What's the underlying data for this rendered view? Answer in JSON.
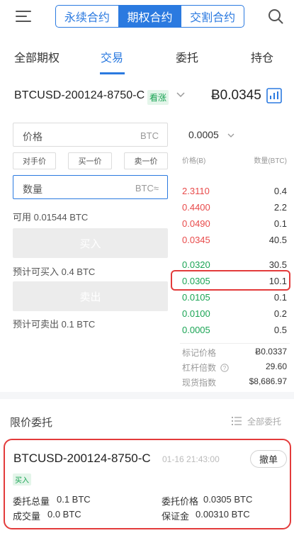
{
  "header": {
    "segments": [
      "永续合约",
      "期权合约",
      "交割合约"
    ],
    "active_segment": 1
  },
  "tabs": [
    "全部期权",
    "交易",
    "委托",
    "持仓"
  ],
  "active_tab": 1,
  "contract": {
    "name": "BTCUSD-200124-8750-C",
    "badge": "看涨",
    "price": "Ƀ0.0345"
  },
  "form": {
    "price_label": "价格",
    "price_unit": "BTC",
    "quick": [
      "对手价",
      "买一价",
      "卖一价"
    ],
    "qty_label": "数量",
    "qty_unit": "BTC≈",
    "available": "可用 0.01544 BTC",
    "buy_label": "买入",
    "est_buy": "预计可买入 0.4 BTC",
    "sell_label": "卖出",
    "est_sell": "预计可卖出 0.1 BTC"
  },
  "orderbook": {
    "depth_select": "0.0005",
    "price_header": "价格(Ƀ)",
    "qty_header": "数量(BTC)",
    "asks": [
      {
        "price": "2.3110",
        "qty": "0.4"
      },
      {
        "price": "0.4400",
        "qty": "2.2"
      },
      {
        "price": "0.0490",
        "qty": "0.1"
      },
      {
        "price": "0.0345",
        "qty": "40.5"
      }
    ],
    "bids": [
      {
        "price": "0.0320",
        "qty": "30.5"
      },
      {
        "price": "0.0305",
        "qty": "10.1"
      },
      {
        "price": "0.0105",
        "qty": "0.1"
      },
      {
        "price": "0.0100",
        "qty": "0.2"
      },
      {
        "price": "0.0005",
        "qty": "0.5"
      }
    ],
    "stats": [
      {
        "label": "标记价格",
        "value": "Ƀ0.0337"
      },
      {
        "label": "杠杆倍数",
        "value": "29.60"
      },
      {
        "label": "现货指数",
        "value": "$8,686.97"
      }
    ]
  },
  "limit_orders": {
    "title": "限价委托",
    "all_label": "全部委托",
    "order": {
      "name": "BTCUSD-200124-8750-C",
      "time": "01-16 21:43:00",
      "cancel": "撤单",
      "side": "买入",
      "total_label": "委托总量",
      "total_value": "0.1 BTC",
      "price_label": "委托价格",
      "price_value": "0.0305 BTC",
      "filled_label": "成交量",
      "filled_value": "0.0 BTC",
      "margin_label": "保证金",
      "margin_value": "0.00310 BTC"
    }
  },
  "colors": {
    "accent": "#2b7ae0",
    "ask": "#e84a4a",
    "bid": "#1aa454",
    "highlight": "#e33b3b"
  }
}
